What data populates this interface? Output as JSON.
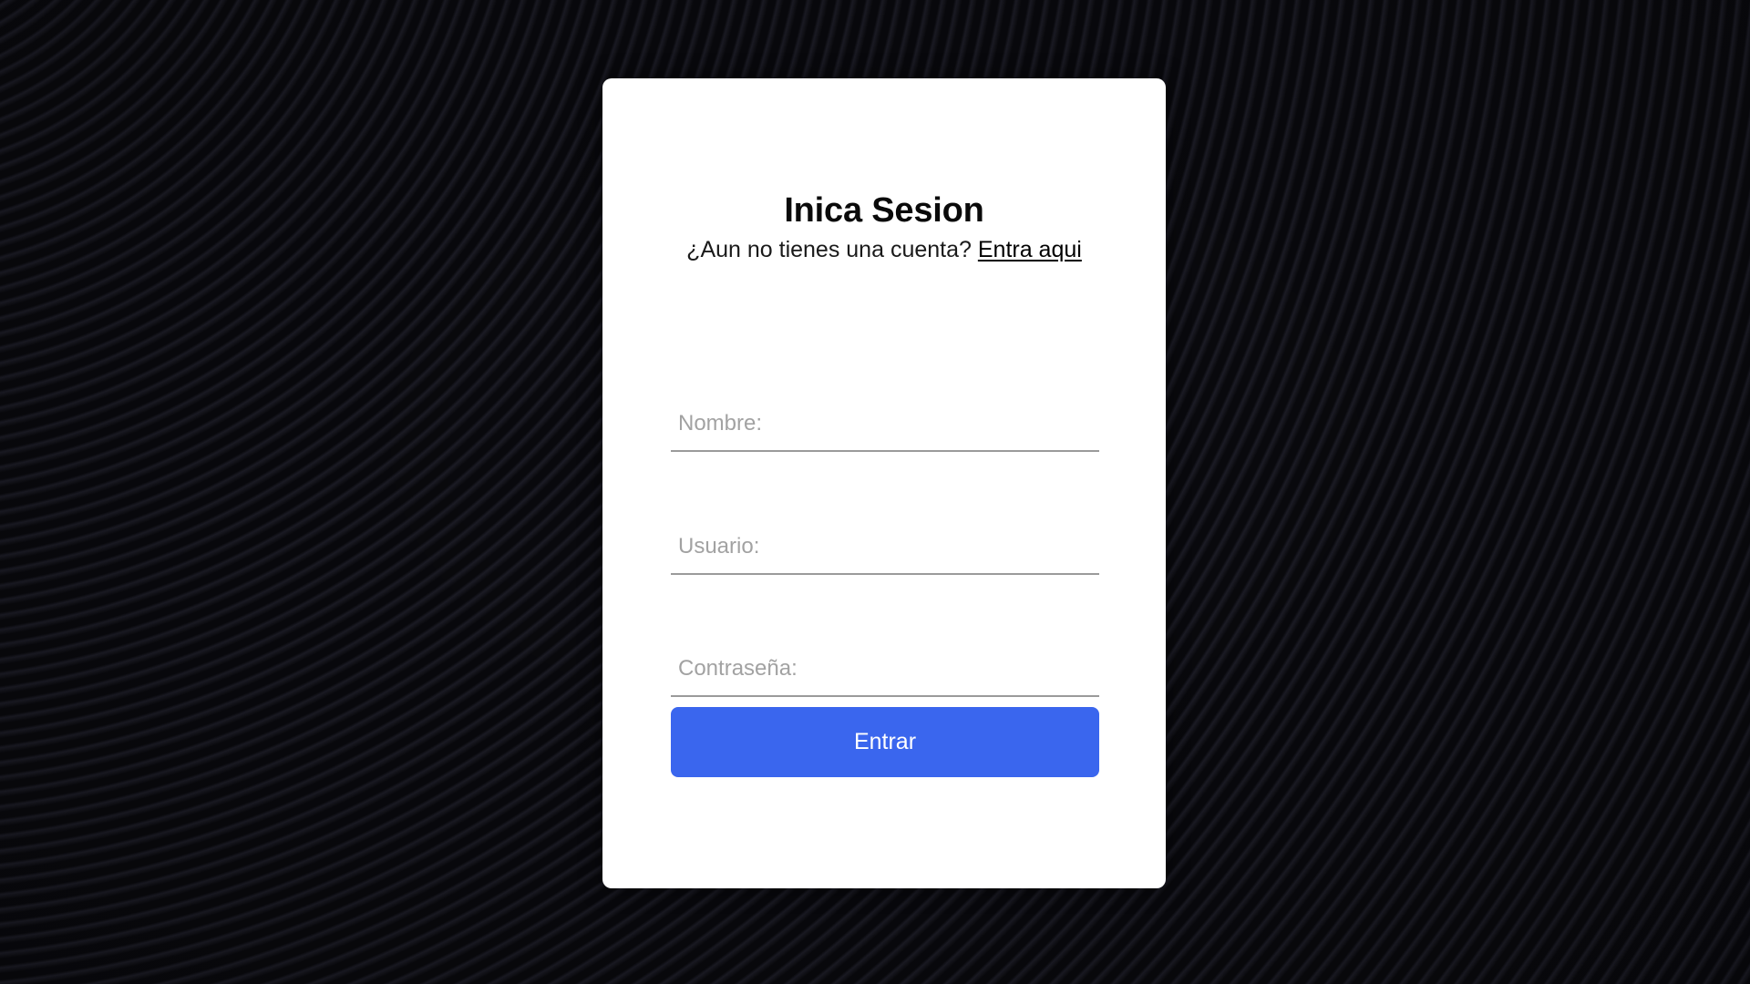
{
  "login": {
    "title": "Inica Sesion",
    "subtitle_text": "¿Aun no tienes una cuenta?",
    "signup_link": "Entra aqui",
    "fields": {
      "name_placeholder": "Nombre:",
      "user_placeholder": "Usuario:",
      "password_placeholder": "Contraseña:"
    },
    "submit_label": "Entrar"
  },
  "colors": {
    "accent": "#3a66ee",
    "card": "#ffffff",
    "background": "#101017"
  }
}
